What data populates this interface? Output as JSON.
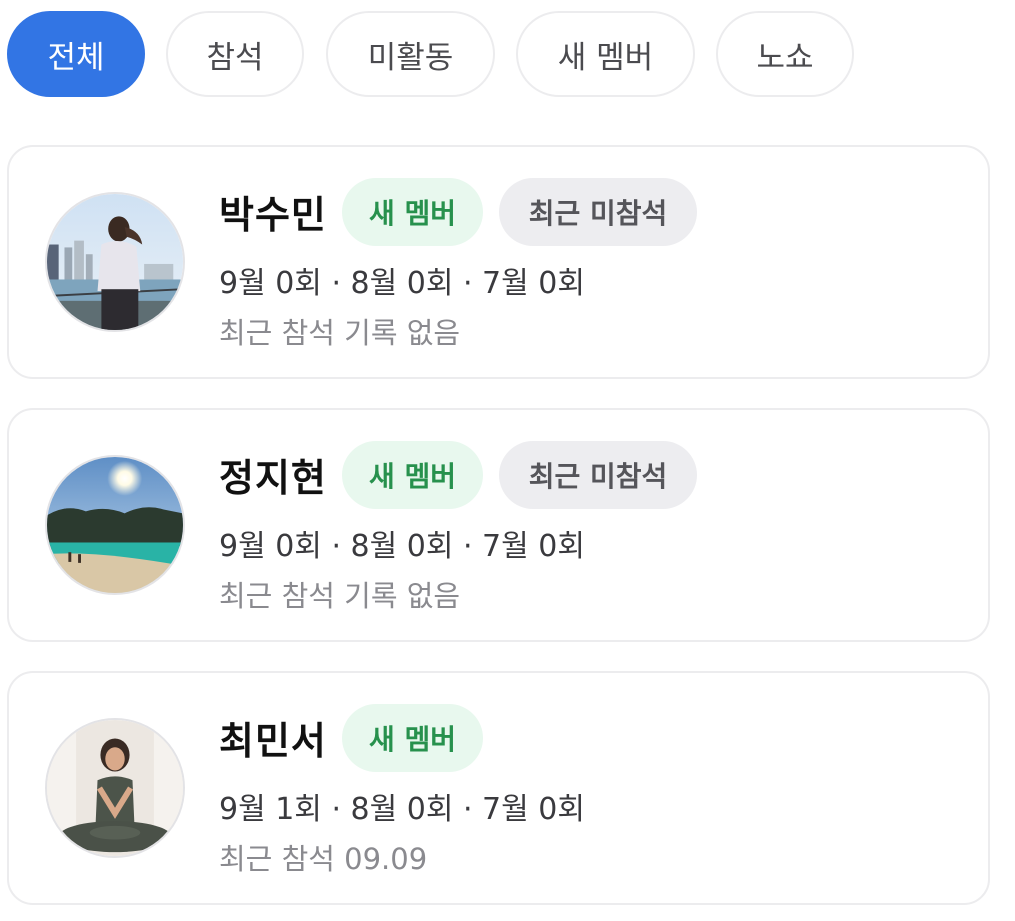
{
  "filters": [
    {
      "label": "전체",
      "active": true
    },
    {
      "label": "참석",
      "active": false
    },
    {
      "label": "미활동",
      "active": false
    },
    {
      "label": "새 멤버",
      "active": false
    },
    {
      "label": "노쇼",
      "active": false
    }
  ],
  "members": [
    {
      "name": "박수민",
      "badges": {
        "new": "새 멤버",
        "absent": "최근 미참석"
      },
      "counts": "9월 0회 · 8월 0회 · 7월 0회",
      "recent": "최근 참석 기록 없음",
      "avatar": "running-woman-photo"
    },
    {
      "name": "정지현",
      "badges": {
        "new": "새 멤버",
        "absent": "최근 미참석"
      },
      "counts": "9월 0회 · 8월 0회 · 7월 0회",
      "recent": "최근 참석 기록 없음",
      "avatar": "beach-photo"
    },
    {
      "name": "최민서",
      "badges": {
        "new": "새 멤버"
      },
      "counts": "9월 1회 · 8월 0회 · 7월 0회",
      "recent": "최근 참석 09.09",
      "avatar": "yoga-woman-photo"
    }
  ],
  "colors": {
    "accent": "#3275e4",
    "new_badge_bg": "#e8f8ee",
    "new_badge_text": "#27914d",
    "absent_badge_bg": "#ededf0"
  }
}
